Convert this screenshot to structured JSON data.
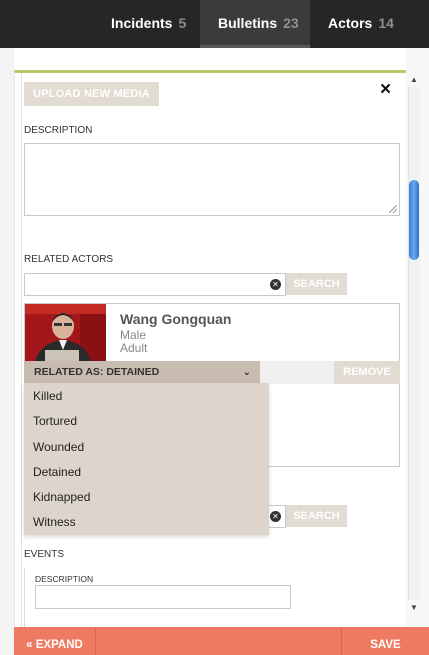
{
  "nav": {
    "tabs": [
      {
        "label": "Incidents",
        "count": "5"
      },
      {
        "label": "Bulletins",
        "count": "23"
      },
      {
        "label": "Actors",
        "count": "14"
      }
    ]
  },
  "panel": {
    "upload_label": "UPLOAD NEW MEDIA",
    "close_label": "×",
    "description_label": "DESCRIPTION",
    "description_value": "",
    "related_actors_label": "RELATED ACTORS",
    "actor_search_value": "",
    "search_label": "SEARCH"
  },
  "actor": {
    "name": "Wang Gongquan",
    "sex": "Male",
    "age": "Adult",
    "related_as": "RELATED AS: DETAINED",
    "remove_label": "REMOVE"
  },
  "relation_dropdown": {
    "options": [
      "Killed",
      "Tortured",
      "Wounded",
      "Detained",
      "Kidnapped",
      "Witness"
    ]
  },
  "events": {
    "label": "EVENTS",
    "description_label": "DESCRIPTION",
    "description_value": "",
    "search_label": "SEARCH"
  },
  "footer": {
    "expand_label": "« EXPAND",
    "save_label": "SAVE"
  },
  "icons": {
    "close": "close-icon",
    "clear": "clear-icon",
    "chevron": "chevron-down-icon",
    "scroll_up": "scroll-up-arrow-icon",
    "scroll_down": "scroll-down-arrow-icon"
  },
  "colors": {
    "accent_bar": "#b6cc6a",
    "button_beige": "#e2dbd2",
    "footer": "#ef7a62",
    "topbar": "#262626"
  }
}
